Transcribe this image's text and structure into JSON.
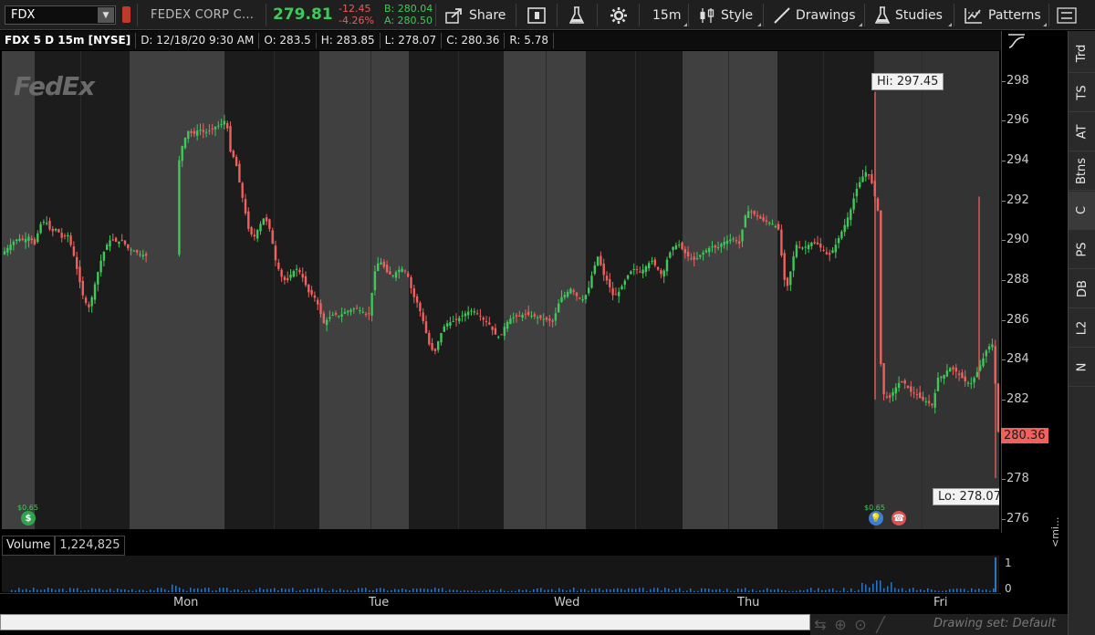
{
  "toolbar": {
    "symbol": "FDX",
    "company": "FEDEX CORP C...",
    "last_price": "279.81",
    "net_change": "-12.45",
    "pct_change": "-4.26%",
    "bid": "B: 280.04",
    "ask": "A: 280.50",
    "share_label": "Share",
    "timeframe_label": "15m",
    "style_label": "Style",
    "drawings_label": "Drawings",
    "studies_label": "Studies",
    "patterns_label": "Patterns"
  },
  "infobar": {
    "title": "FDX 5 D 15m [NYSE]",
    "date": "D: 12/18/20 9:30 AM",
    "open": "O: 283.5",
    "high": "H: 283.85",
    "low": "L: 278.07",
    "close": "C: 280.36",
    "range": "R: 5.78"
  },
  "chart": {
    "watermark": "FedEx",
    "hi_label": "Hi: 297.45",
    "lo_label": "Lo: 278.07",
    "last_tag": "280.36",
    "dividend_1": "$0.65",
    "dividend_2": "$0.65",
    "y_ticks": [
      "298",
      "296",
      "294",
      "292",
      "290",
      "288",
      "286",
      "284",
      "282",
      "280",
      "278",
      "276"
    ],
    "x_ticks": [
      "Mon",
      "Tue",
      "Wed",
      "Thu",
      "Fri"
    ],
    "colors": {
      "up": "#3ec95a",
      "down": "#f0605c",
      "volume": "#2f74c0"
    }
  },
  "chart_data": {
    "type": "candlestick",
    "title": "FDX 5 D 15m [NYSE]",
    "ylim": [
      275.5,
      299.5
    ],
    "y_ticks": [
      276,
      278,
      280,
      282,
      284,
      286,
      288,
      290,
      292,
      294,
      296,
      298
    ],
    "x_ticks": [
      "Mon",
      "Tue",
      "Wed",
      "Thu",
      "Fri"
    ],
    "hi": 297.45,
    "lo": 278.07,
    "last": 280.36,
    "path": [
      [
        0,
        289.3
      ],
      [
        6,
        289.6
      ],
      [
        12,
        289.9
      ],
      [
        18,
        290.1
      ],
      [
        24,
        290.0
      ],
      [
        30,
        290.2
      ],
      [
        36,
        289.8
      ],
      [
        42,
        290.8
      ],
      [
        48,
        291.0
      ],
      [
        54,
        290.4
      ],
      [
        60,
        290.6
      ],
      [
        66,
        290.1
      ],
      [
        72,
        290.3
      ],
      [
        78,
        289.4
      ],
      [
        84,
        288.2
      ],
      [
        90,
        287.0
      ],
      [
        96,
        286.6
      ],
      [
        102,
        287.8
      ],
      [
        108,
        288.9
      ],
      [
        114,
        289.7
      ],
      [
        120,
        290.1
      ],
      [
        126,
        289.9
      ],
      [
        132,
        290.0
      ],
      [
        138,
        289.6
      ],
      [
        144,
        289.5
      ],
      [
        152,
        289.3
      ],
      [
        160,
        289.2
      ],
      [
        170,
        289.4
      ],
      [
        182,
        289.4
      ],
      [
        192,
        293.5
      ],
      [
        198,
        294.8
      ],
      [
        204,
        295.5
      ],
      [
        210,
        295.3
      ],
      [
        216,
        295.6
      ],
      [
        222,
        295.4
      ],
      [
        228,
        295.5
      ],
      [
        234,
        295.7
      ],
      [
        240,
        295.8
      ],
      [
        246,
        296.1
      ],
      [
        250,
        294.5
      ],
      [
        256,
        294.0
      ],
      [
        260,
        293.0
      ],
      [
        266,
        291.6
      ],
      [
        270,
        290.6
      ],
      [
        276,
        290.1
      ],
      [
        282,
        290.7
      ],
      [
        288,
        291.2
      ],
      [
        294,
        290.5
      ],
      [
        300,
        289.0
      ],
      [
        306,
        288.2
      ],
      [
        312,
        287.9
      ],
      [
        318,
        288.4
      ],
      [
        324,
        288.6
      ],
      [
        330,
        288.1
      ],
      [
        336,
        287.4
      ],
      [
        342,
        287.2
      ],
      [
        348,
        286.6
      ],
      [
        352,
        285.8
      ],
      [
        358,
        286.1
      ],
      [
        364,
        286.3
      ],
      [
        370,
        286.2
      ],
      [
        376,
        286.4
      ],
      [
        382,
        286.5
      ],
      [
        388,
        286.6
      ],
      [
        396,
        286.4
      ],
      [
        402,
        286.2
      ],
      [
        410,
        288.8
      ],
      [
        416,
        288.9
      ],
      [
        422,
        288.4
      ],
      [
        428,
        288.2
      ],
      [
        434,
        288.5
      ],
      [
        440,
        288.6
      ],
      [
        446,
        288.1
      ],
      [
        450,
        287.3
      ],
      [
        456,
        286.8
      ],
      [
        462,
        285.9
      ],
      [
        468,
        284.8
      ],
      [
        474,
        284.3
      ],
      [
        480,
        285.2
      ],
      [
        486,
        285.8
      ],
      [
        492,
        285.9
      ],
      [
        498,
        286.0
      ],
      [
        504,
        286.2
      ],
      [
        510,
        286.4
      ],
      [
        516,
        286.5
      ],
      [
        522,
        286.3
      ],
      [
        528,
        286.0
      ],
      [
        534,
        285.8
      ],
      [
        540,
        285.3
      ],
      [
        546,
        285.1
      ],
      [
        552,
        285.8
      ],
      [
        558,
        286.1
      ],
      [
        566,
        286.2
      ],
      [
        574,
        286.3
      ],
      [
        582,
        286.2
      ],
      [
        590,
        286.1
      ],
      [
        598,
        286.0
      ],
      [
        604,
        285.9
      ],
      [
        612,
        287.1
      ],
      [
        618,
        287.3
      ],
      [
        624,
        287.6
      ],
      [
        630,
        287.2
      ],
      [
        636,
        287.0
      ],
      [
        642,
        287.4
      ],
      [
        648,
        288.5
      ],
      [
        654,
        289.3
      ],
      [
        658,
        288.4
      ],
      [
        664,
        287.9
      ],
      [
        670,
        287.2
      ],
      [
        676,
        287.4
      ],
      [
        682,
        287.9
      ],
      [
        688,
        288.4
      ],
      [
        694,
        288.6
      ],
      [
        700,
        288.4
      ],
      [
        706,
        288.7
      ],
      [
        712,
        289.0
      ],
      [
        718,
        288.6
      ],
      [
        724,
        288.2
      ],
      [
        730,
        289.2
      ],
      [
        736,
        289.7
      ],
      [
        742,
        289.8
      ],
      [
        748,
        289.4
      ],
      [
        754,
        289.1
      ],
      [
        760,
        289.0
      ],
      [
        766,
        289.3
      ],
      [
        772,
        289.5
      ],
      [
        778,
        289.7
      ],
      [
        784,
        289.6
      ],
      [
        790,
        289.9
      ],
      [
        796,
        290.0
      ],
      [
        802,
        290.1
      ],
      [
        808,
        289.8
      ],
      [
        816,
        291.5
      ],
      [
        822,
        291.4
      ],
      [
        828,
        291.2
      ],
      [
        834,
        291.0
      ],
      [
        840,
        290.9
      ],
      [
        846,
        290.8
      ],
      [
        852,
        290.5
      ],
      [
        856,
        288.4
      ],
      [
        860,
        287.5
      ],
      [
        866,
        288.8
      ],
      [
        870,
        289.8
      ],
      [
        876,
        289.6
      ],
      [
        882,
        289.7
      ],
      [
        888,
        289.9
      ],
      [
        894,
        289.8
      ],
      [
        900,
        289.5
      ],
      [
        906,
        289.2
      ],
      [
        912,
        289.6
      ],
      [
        918,
        290.2
      ],
      [
        924,
        290.8
      ],
      [
        930,
        291.5
      ],
      [
        936,
        292.5
      ],
      [
        942,
        293.1
      ],
      [
        948,
        293.5
      ],
      [
        954,
        292.8
      ],
      [
        960,
        291.5
      ],
      [
        962,
        284.5
      ],
      [
        966,
        282.3
      ],
      [
        972,
        282.0
      ],
      [
        978,
        282.5
      ],
      [
        984,
        282.9
      ],
      [
        990,
        282.8
      ],
      [
        996,
        282.4
      ],
      [
        1002,
        282.3
      ],
      [
        1008,
        282.0
      ],
      [
        1014,
        281.9
      ],
      [
        1020,
        281.7
      ],
      [
        1026,
        283.1
      ],
      [
        1032,
        283.2
      ],
      [
        1038,
        283.6
      ],
      [
        1044,
        283.5
      ],
      [
        1050,
        283.2
      ],
      [
        1056,
        282.9
      ],
      [
        1062,
        282.8
      ],
      [
        1068,
        283.3
      ],
      [
        1074,
        283.9
      ],
      [
        1080,
        284.6
      ],
      [
        1086,
        284.8
      ],
      [
        1092,
        280.4
      ]
    ]
  },
  "volume": {
    "label": "Volume",
    "value": "1,224,825",
    "ticks": [
      "1",
      "0"
    ],
    "side_label": "<mi..."
  },
  "side_tabs": [
    "Trd",
    "TS",
    "AT",
    "Btns",
    "C",
    "PS",
    "DB",
    "L2",
    "N"
  ],
  "bottom": {
    "drawing_set": "Drawing set: Default"
  }
}
